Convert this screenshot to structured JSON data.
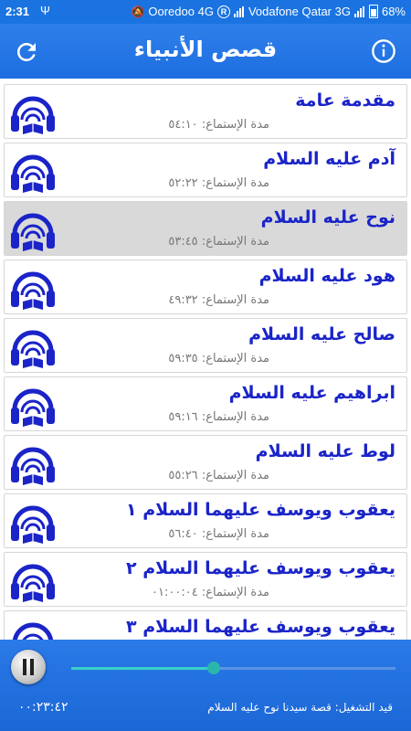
{
  "status_bar": {
    "time": "2:31",
    "carrier1": "Ooredoo 4G",
    "carrier2": "Vodafone Qatar 3G",
    "battery": "68%"
  },
  "app_bar": {
    "title": "قصص الأنبياء",
    "refresh_icon": "refresh-icon",
    "info_icon": "info-icon"
  },
  "duration_label": "مدة الإستماع:",
  "stories": [
    {
      "title": "مقدمة عامة",
      "duration": "٥٤:١٠",
      "selected": false
    },
    {
      "title": "آدم عليه السلام",
      "duration": "٥٢:٢٢",
      "selected": false
    },
    {
      "title": "نوح عليه السلام",
      "duration": "٥٣:٤٥",
      "selected": true
    },
    {
      "title": "هود عليه السلام",
      "duration": "٤٩:٣٢",
      "selected": false
    },
    {
      "title": "صالح عليه السلام",
      "duration": "٥٩:٣٥",
      "selected": false
    },
    {
      "title": "ابراهيم عليه السلام",
      "duration": "٥٩:١٦",
      "selected": false
    },
    {
      "title": "لوط عليه السلام",
      "duration": "٥٥:٢٦",
      "selected": false
    },
    {
      "title": "يعقوب ويوسف عليهما السلام ١",
      "duration": "٥٦:٤٠",
      "selected": false
    },
    {
      "title": "يعقوب ويوسف عليهما السلام ٢",
      "duration": "٠١:٠٠:٠٤",
      "selected": false
    },
    {
      "title": "يعقوب ويوسف عليهما السلام ٣",
      "duration": "",
      "selected": false
    }
  ],
  "player": {
    "elapsed": "٠٠:٢٣:٤٢",
    "now_playing": "قيد التشغيل: قصة سيدنا نوح عليه السلام",
    "progress": 0.44,
    "accent": "#2bb6ac"
  }
}
